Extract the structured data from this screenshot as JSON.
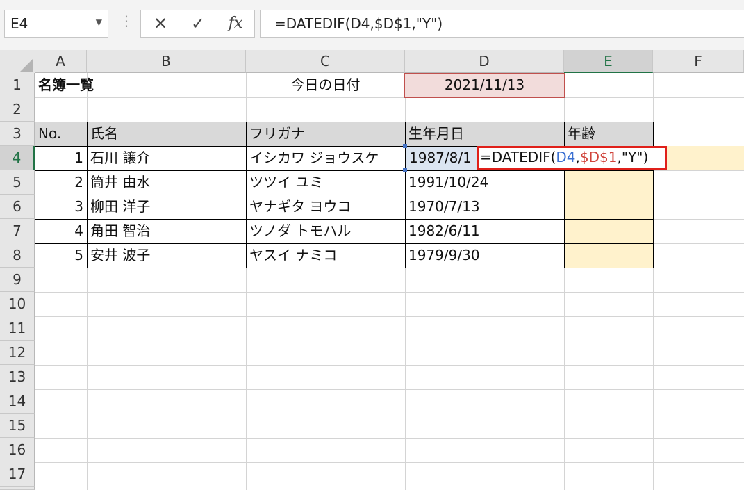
{
  "name_box": {
    "value": "E4"
  },
  "formula_bar": {
    "cancel_icon": "✕",
    "enter_icon": "✓",
    "fx_label": "fx",
    "formula": "=DATEDIF(D4,$D$1,\"Y\")"
  },
  "columns": [
    "A",
    "B",
    "C",
    "D",
    "E",
    "F"
  ],
  "rows": [
    "1",
    "2",
    "3",
    "4",
    "5",
    "6",
    "7",
    "8",
    "9",
    "10",
    "11",
    "12",
    "13",
    "14",
    "15",
    "16",
    "17"
  ],
  "cells": {
    "title": "名簿一覧",
    "today_label": "今日の日付",
    "today_date": "2021/11/13"
  },
  "table": {
    "headers": [
      "No.",
      "氏名",
      "フリガナ",
      "生年月日",
      "年齢"
    ],
    "rows": [
      {
        "no": "1",
        "name": "石川 譲介",
        "kana": "イシカワ ジョウスケ",
        "birth": "1987/8/1"
      },
      {
        "no": "2",
        "name": "筒井 由水",
        "kana": "ツツイ ユミ",
        "birth": "1991/10/24"
      },
      {
        "no": "3",
        "name": "柳田 洋子",
        "kana": "ヤナギタ ヨウコ",
        "birth": "1970/7/13"
      },
      {
        "no": "4",
        "name": "角田 智治",
        "kana": "ツノダ トモハル",
        "birth": "1982/6/11"
      },
      {
        "no": "5",
        "name": "安井 波子",
        "kana": "ヤスイ ナミコ",
        "birth": "1979/9/30"
      }
    ]
  },
  "in_cell_edit": {
    "prefix": "=DATEDIF(",
    "ref1": "D4",
    "comma1": ",",
    "ref2": "$D$1",
    "suffix": ",\"Y\")"
  },
  "colors": {
    "active_header": "#217346",
    "highlight_orange": "#fff2cc",
    "edit_border": "#e0201a",
    "ref_blue": "#3a6fd2",
    "ref_red": "#d0433a"
  }
}
